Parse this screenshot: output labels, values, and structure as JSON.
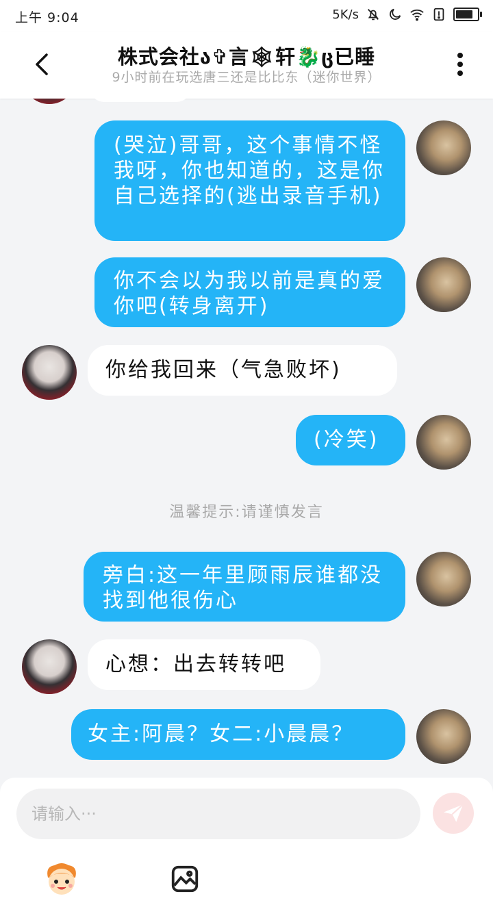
{
  "status": {
    "time": "上午 9:04",
    "net_speed": "5K/s"
  },
  "header": {
    "title": "株式会社ა✞言🕸轩🐉ც已睡",
    "subtitle": "9小时前在玩选唐三还是比比东（迷你世界）"
  },
  "messages": [
    {
      "side": "out",
      "text": "(哭泣)哥哥，这个事情不怪我呀，你也知道的，这是你自己选择的(逃出录音手机)"
    },
    {
      "side": "out",
      "text": "你不会以为我以前是真的爱你吧(转身离开)"
    },
    {
      "side": "in",
      "text": "你给我回来（气急败坏)"
    },
    {
      "side": "out",
      "text": "(冷笑)"
    },
    {
      "side": "out",
      "text": "旁白:这一年里顾雨辰谁都没找到他很伤心"
    },
    {
      "side": "in",
      "text": "心想：出去转转吧"
    },
    {
      "side": "out",
      "text": "女主:阿晨？女二:小晨晨？"
    }
  ],
  "notice": "温馨提示:请谨慎发言",
  "composer": {
    "placeholder": "请输入···"
  },
  "colors": {
    "bubble_out": "#24b4f7",
    "bubble_in": "#ffffff",
    "background": "#f3f4f6",
    "send_button": "#fbe2e2"
  },
  "icons": {
    "back": "chevron-left-icon",
    "more": "more-vertical-icon",
    "send": "paper-plane-icon",
    "emoji": "mascot-emoji-icon",
    "image": "image-icon"
  }
}
